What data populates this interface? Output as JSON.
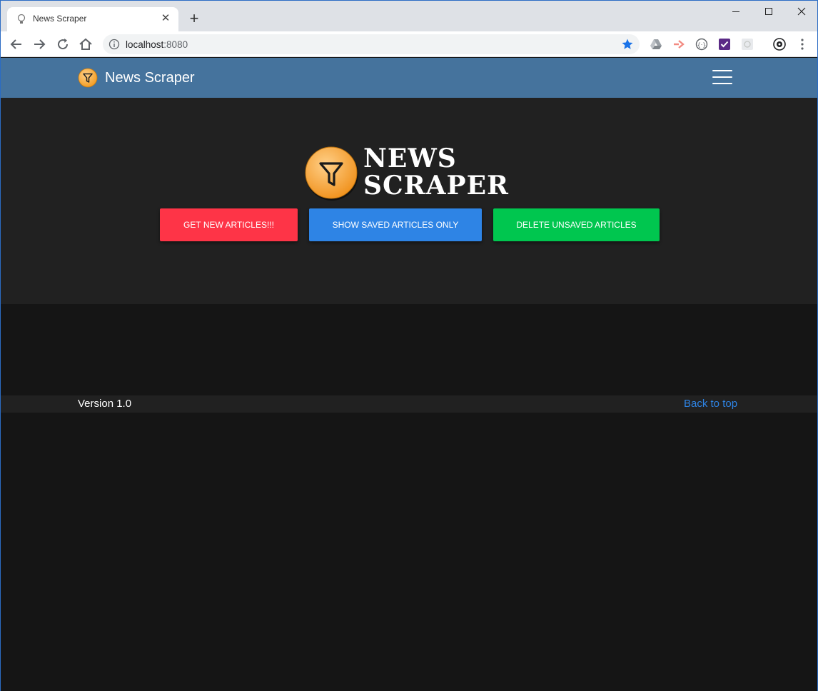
{
  "browser": {
    "tab_title": "News Scraper",
    "url_host": "localhost",
    "url_port": ":8080",
    "accent_color": "#1a73e8"
  },
  "navbar": {
    "brand": "News Scraper",
    "bg_color": "#45739d"
  },
  "hero": {
    "title_line1": "NEWS",
    "title_line2": "SCRAPER",
    "buttons": {
      "get_new": "GET NEW ARTICLES!!!",
      "show_saved": "SHOW SAVED ARTICLES ONLY",
      "delete_unsaved": "DELETE UNSAVED ARTICLES"
    },
    "button_colors": {
      "red": "#fe3447",
      "blue": "#2e84e5",
      "green": "#00c64f"
    }
  },
  "footer": {
    "version": "Version 1.0",
    "back_to_top": "Back to top"
  },
  "icons": [
    "page-favicon-icon",
    "close-icon",
    "plus-icon",
    "minimize-icon",
    "maximize-icon",
    "window-close-icon",
    "back-arrow-icon",
    "forward-arrow-icon",
    "reload-icon",
    "home-icon",
    "info-icon",
    "star-icon",
    "drive-extension-icon",
    "extension-icon",
    "menu-dots-icon",
    "funnel-logo-icon",
    "hamburger-icon"
  ]
}
